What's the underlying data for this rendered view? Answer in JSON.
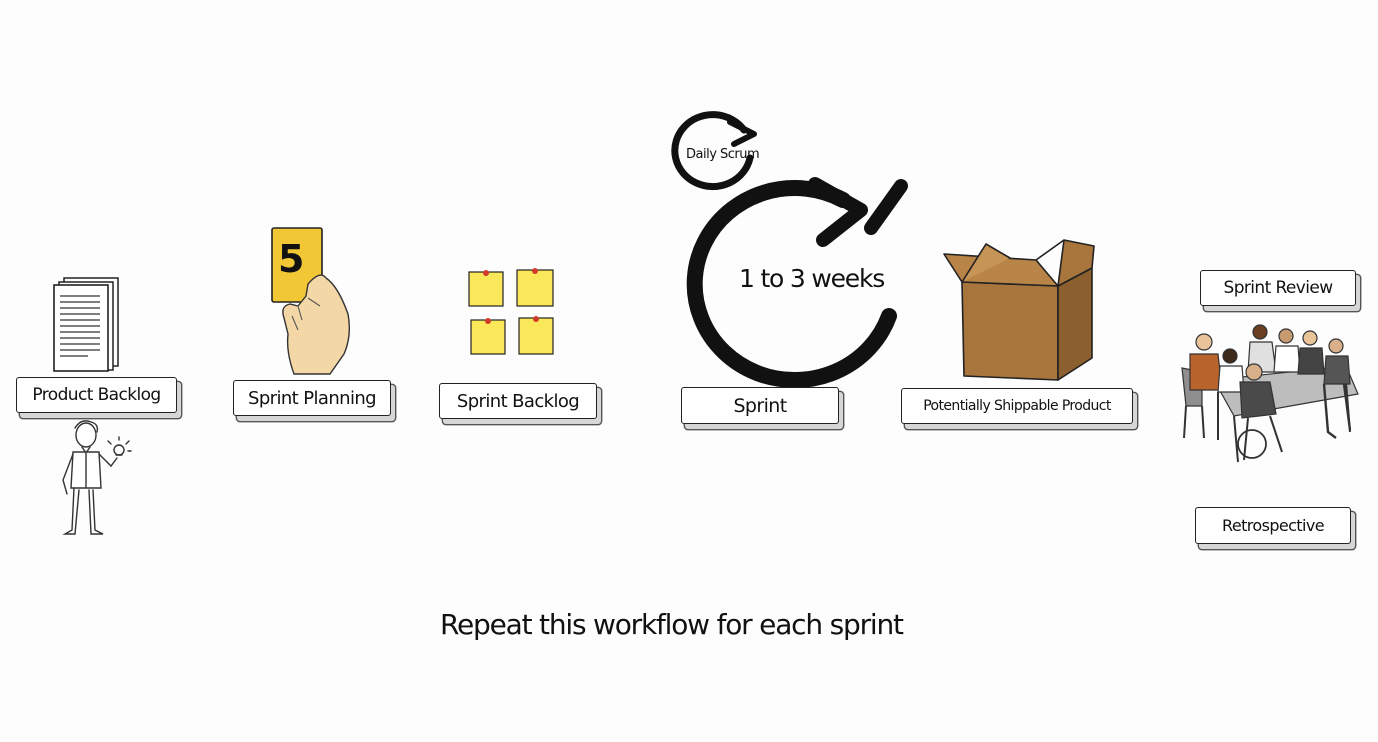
{
  "steps": {
    "product_backlog": "Product Backlog",
    "sprint_planning": "Sprint Planning",
    "sprint_backlog": "Sprint Backlog",
    "sprint": "Sprint",
    "shippable_product": "Potentially Shippable Product",
    "sprint_review": "Sprint Review",
    "retrospective": "Retrospective"
  },
  "cycle": {
    "daily_scrum": "Daily Scrum",
    "duration": "1 to 3 weeks"
  },
  "planning_card_value": "5",
  "caption": "Repeat this workflow for each sprint",
  "colors": {
    "ink": "#111111",
    "sticky_note": "#fbe85a",
    "card": "#f2c735",
    "box": "#a8753c",
    "skin": "#f3d7a6"
  }
}
